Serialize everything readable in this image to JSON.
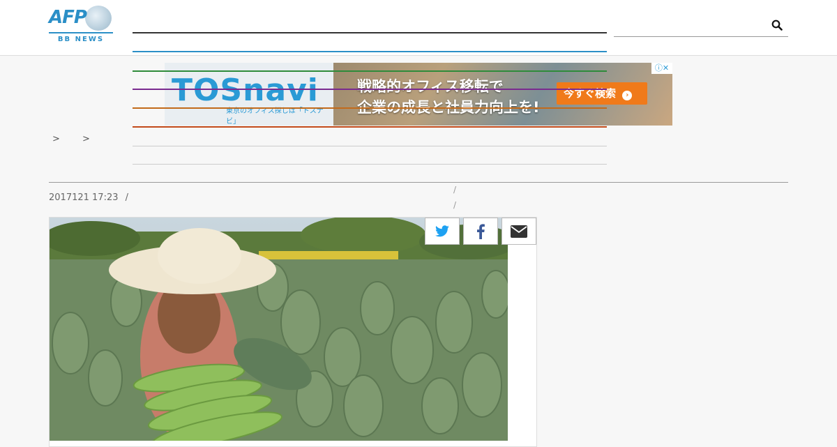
{
  "header": {
    "logo_text": "AFP",
    "logo_sub": "BB NEWS",
    "search_icon": "search-icon"
  },
  "ad": {
    "brand": "TOSnavi",
    "tagline": "東京のオフィス探しは「トスナビ」",
    "copy_line1": "戦略的オフィス移転で",
    "copy_line2": "企業の成長と社員力向上を!",
    "cta": "今すぐ検索",
    "close_label": "ⓘ✕"
  },
  "breadcrumb": {
    "sep1": ">",
    "sep2": ">"
  },
  "article": {
    "title": "",
    "date": "2017121 17:23",
    "meta_sep": "/"
  },
  "share": {
    "twitter_icon": "twitter-icon",
    "facebook_icon": "facebook-icon",
    "mail_icon": "mail-icon"
  },
  "colors": {
    "brand_blue": "#2b8fc7",
    "nav_lines": [
      "#333333",
      "#2b8fc7",
      "#2e8b3a",
      "#7a2a8f",
      "#c26a1a",
      "#c24a1a"
    ],
    "cta_orange": "#f07a1a"
  }
}
